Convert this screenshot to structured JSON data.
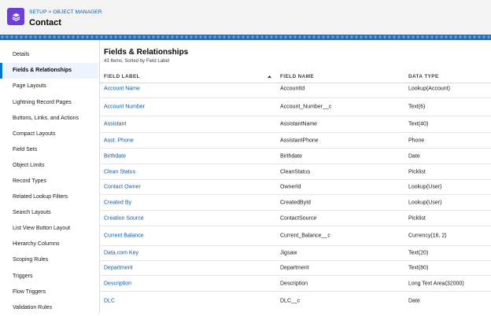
{
  "header": {
    "breadcrumb": {
      "setup": "SETUP",
      "separator": ">",
      "object_manager": "OBJECT MANAGER"
    },
    "title": "Contact",
    "icon": "layers-icon",
    "colors": {
      "icon_bg": "#6e3ed8",
      "brand_band": "#2f6db5",
      "link": "#0b5cab"
    }
  },
  "sidebar": {
    "items": [
      {
        "label": "Details"
      },
      {
        "label": "Fields & Relationships",
        "active": true
      },
      {
        "label": "Page Layouts"
      },
      {
        "label": "Lightning Record Pages"
      },
      {
        "label": "Buttons, Links, and Actions"
      },
      {
        "label": "Compact Layouts"
      },
      {
        "label": "Field Sets"
      },
      {
        "label": "Object Limits"
      },
      {
        "label": "Record Types"
      },
      {
        "label": "Related Lookup Filters"
      },
      {
        "label": "Search Layouts"
      },
      {
        "label": "List View Button Layout"
      },
      {
        "label": "Hierarchy Columns"
      },
      {
        "label": "Scoping Rules"
      },
      {
        "label": "Triggers"
      },
      {
        "label": "Flow Triggers"
      },
      {
        "label": "Validation Rules"
      }
    ]
  },
  "main": {
    "title": "Fields & Relationships",
    "subtitle": "43 Items, Sorted by Field Label",
    "columns": [
      "FIELD LABEL",
      "FIELD NAME",
      "DATA TYPE"
    ],
    "sort_icon": "sort-up-icon",
    "rows": [
      {
        "label": "Account Name",
        "name": "AccountId",
        "type": "Lookup(Account)"
      },
      {
        "label": "Account Number",
        "name": "Account_Number__c",
        "type": "Text(6)"
      },
      {
        "label": "Assistant",
        "name": "AssistantName",
        "type": "Text(40)"
      },
      {
        "label": "Asst. Phone",
        "name": "AssistantPhone",
        "type": "Phone"
      },
      {
        "label": "Birthdate",
        "name": "Birthdate",
        "type": "Date"
      },
      {
        "label": "Clean Status",
        "name": "CleanStatus",
        "type": "Picklist"
      },
      {
        "label": "Contact Owner",
        "name": "OwnerId",
        "type": "Lookup(User)"
      },
      {
        "label": "Created By",
        "name": "CreatedById",
        "type": "Lookup(User)"
      },
      {
        "label": "Creation Source",
        "name": "ContactSource",
        "type": "Picklist"
      },
      {
        "label": "Current Balance",
        "name": "Current_Balance__c",
        "type": "Currency(16, 2)"
      },
      {
        "label": "Data.com Key",
        "name": "Jigsaw",
        "type": "Text(20)"
      },
      {
        "label": "Department",
        "name": "Department",
        "type": "Text(80)"
      },
      {
        "label": "Description",
        "name": "Description",
        "type": "Long Text Area(32000)"
      },
      {
        "label": "DLC",
        "name": "DLC__c",
        "type": "Date"
      }
    ]
  }
}
